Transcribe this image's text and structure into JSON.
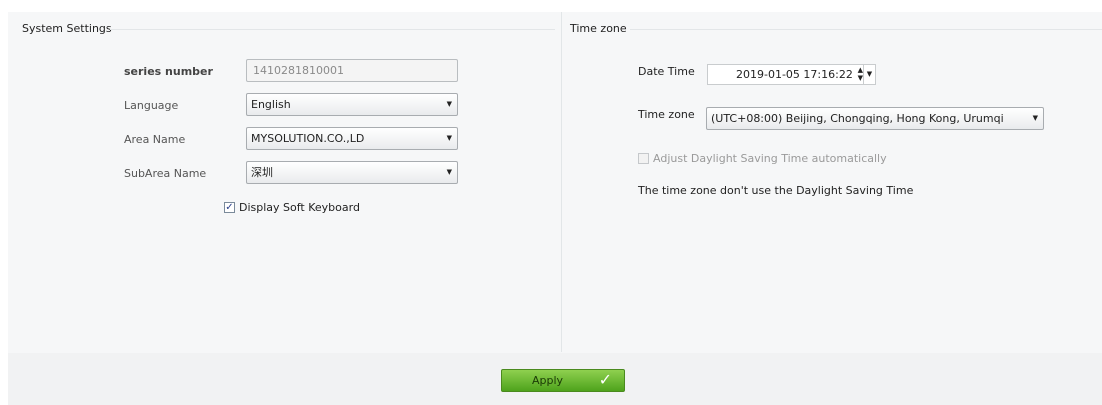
{
  "system_settings": {
    "title": "System Settings",
    "series_number_label": "series number",
    "series_number_value": "1410281810001",
    "language_label": "Language",
    "language_value": "English",
    "area_name_label": "Area Name",
    "area_name_value": "MYSOLUTION.CO.,LD",
    "subarea_name_label": "SubArea Name",
    "subarea_name_value": "深圳",
    "soft_keyboard_label": "Display Soft Keyboard",
    "soft_keyboard_checked": true
  },
  "time_zone": {
    "title": "Time zone",
    "date_time_label": "Date Time",
    "date_time_value": "2019-01-05 17:16:22",
    "time_zone_label": "Time zone",
    "time_zone_value": "(UTC+08:00) Beijing, Chongqing, Hong Kong, Urumqi",
    "dst_label": "Adjust Daylight Saving Time automatically",
    "dst_checked": false,
    "dst_enabled": false,
    "dst_note": "The time zone don't use the Daylight Saving Time"
  },
  "footer": {
    "apply_label": "Apply"
  },
  "icons": {
    "dropdown": "chevron-down-icon",
    "spin": "spin-updown-icon",
    "apply": "checkmark-icon"
  },
  "colors": {
    "apply_button": "#5fb52a",
    "checkbox_mark": "#2a3f8a"
  }
}
